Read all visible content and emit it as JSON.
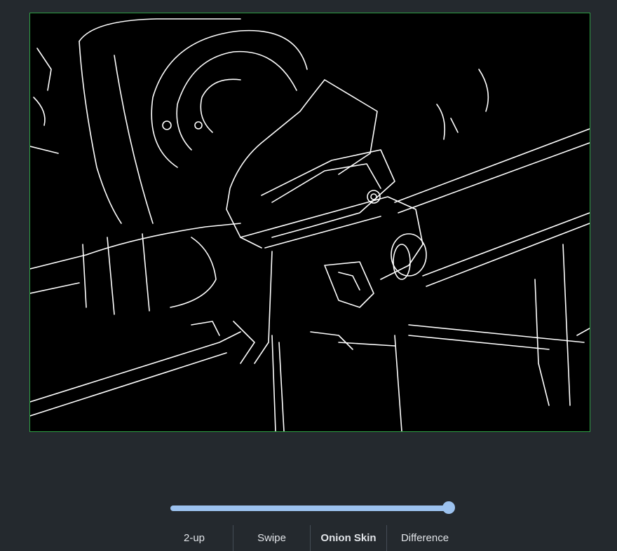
{
  "view": {
    "image_alt": "edge-detected photograph of machinery",
    "frame_color": "#2ea043",
    "slider": {
      "value": 1.0
    },
    "modes": [
      {
        "label": "2-up",
        "active": false
      },
      {
        "label": "Swipe",
        "active": false
      },
      {
        "label": "Onion Skin",
        "active": true
      },
      {
        "label": "Difference",
        "active": false
      }
    ]
  }
}
